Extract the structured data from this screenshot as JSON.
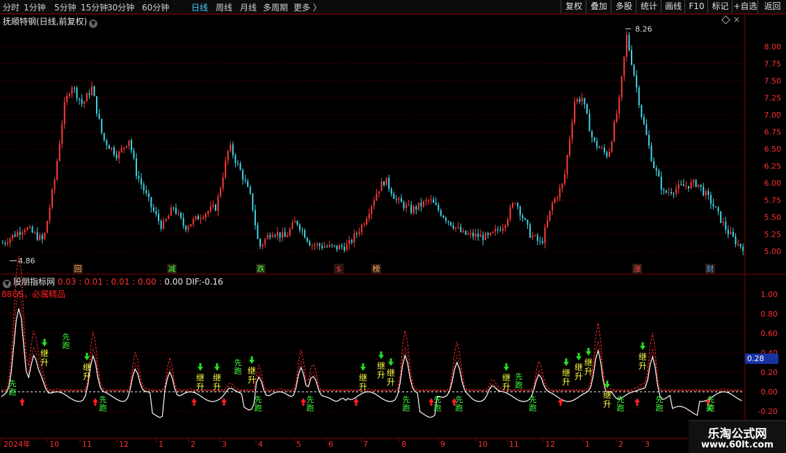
{
  "toolbar": {
    "timeframes": [
      "分时",
      "1分钟",
      "5分钟",
      "15分钟",
      "30分钟",
      "60分钟",
      "日线",
      "周线",
      "月线",
      "多周期",
      "更多"
    ],
    "active_timeframe": "日线",
    "buttons": [
      "复权",
      "叠加",
      "多股",
      "统计",
      "画线",
      "F10",
      "标记",
      "+自选",
      "返回"
    ]
  },
  "main_chart": {
    "title": "抚顺特钢(日线,前复权)",
    "y_ticks": [
      "8.00",
      "7.75",
      "7.50",
      "7.25",
      "7.00",
      "6.75",
      "6.50",
      "6.25",
      "6.00",
      "5.75",
      "5.50",
      "5.25",
      "5.00"
    ],
    "high_label": "8.26",
    "low_label": "4.86",
    "event_tags": [
      {
        "text": "回",
        "color": "#ffb060"
      },
      {
        "text": "减",
        "color": "#40ff40"
      },
      {
        "text": "跌",
        "color": "#40ff40"
      },
      {
        "text": "$",
        "color": "#ff3030"
      },
      {
        "text": "榜",
        "color": "#ffb060"
      },
      {
        "text": "涨",
        "color": "#ff5050"
      },
      {
        "text": "财",
        "color": "#50a0ff"
      }
    ]
  },
  "indicator": {
    "name": "股朋指标网",
    "values": [
      "0.03",
      "0.01",
      "0.01",
      "0.00",
      "0.00"
    ],
    "dif_label": "DIF:",
    "dif_value": "-0.16",
    "brand": "88GS，必属精品",
    "y_ticks": [
      "1.00",
      "0.80",
      "0.60",
      "0.40",
      "0.20",
      "0.00",
      "-0.20"
    ],
    "current_value": "0.28",
    "signal_words": {
      "continue": "继",
      "rise": "升",
      "first": "先",
      "run": "跑",
      "buy": "买"
    }
  },
  "x_axis": {
    "labels": [
      "2024年",
      "10",
      "11",
      "12",
      "1",
      "2",
      "3",
      "4",
      "5",
      "6",
      "7",
      "8",
      "9",
      "10",
      "11",
      "12",
      "1",
      "2",
      "3"
    ]
  },
  "watermark": {
    "main": "乐淘公式网",
    "url": "www.60lt.com"
  },
  "colors": {
    "up": "#ff3b3b",
    "down": "#3fd7e8",
    "grid": "#7a0000",
    "dif": "#ffffff",
    "band": "#ff2a2a"
  },
  "chart_data": {
    "type": "candlestick",
    "price_range": [
      4.86,
      8.26
    ],
    "indicator_range": [
      -0.2,
      1.0
    ]
  }
}
